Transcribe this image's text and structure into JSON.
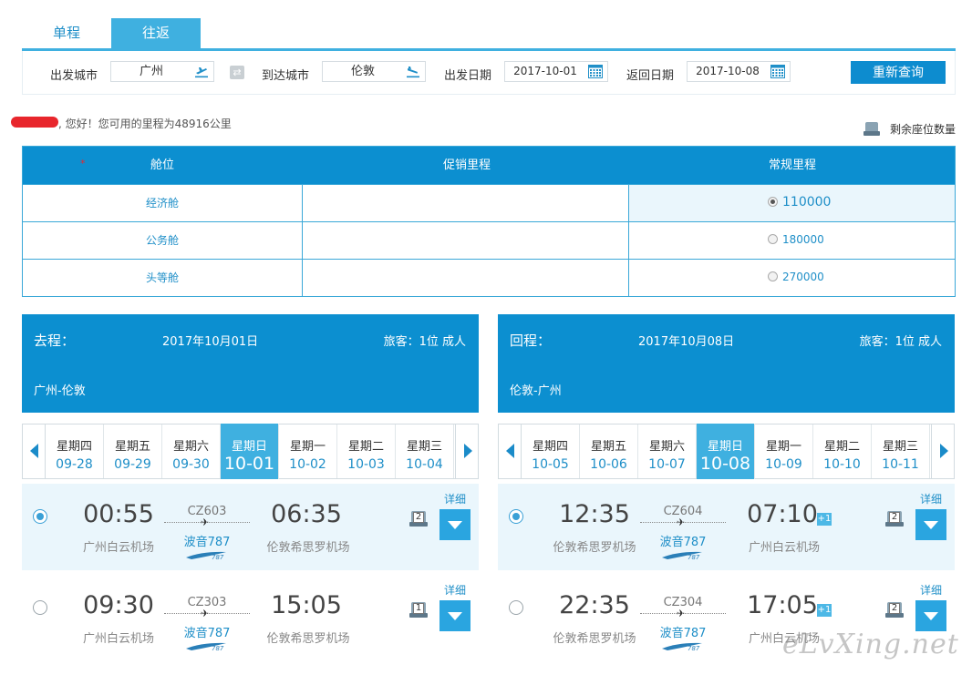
{
  "tabs": [
    {
      "label": "单程",
      "active": false
    },
    {
      "label": "往返",
      "active": true
    }
  ],
  "search": {
    "from_label": "出发城市",
    "from_value": "广州",
    "to_label": "到达城市",
    "to_value": "伦敦",
    "depart_label": "出发日期",
    "depart_value": "2017-10-01",
    "return_label": "返回日期",
    "return_value": "2017-10-08",
    "requery_label": "重新查询"
  },
  "greeting": ", 您好！您可用的里程为48916公里",
  "seat_legend": "剩余座位数量",
  "cabin_table": {
    "headers": [
      "舱位",
      "促销里程",
      "常规里程"
    ],
    "rows": [
      {
        "cabin": "经济舱",
        "promo": "",
        "regular": "110000",
        "selected": true
      },
      {
        "cabin": "公务舱",
        "promo": "",
        "regular": "180000",
        "selected": false
      },
      {
        "cabin": "头等舱",
        "promo": "",
        "regular": "270000",
        "selected": false
      }
    ]
  },
  "outbound": {
    "title": "去程：",
    "date": "2017年10月01日",
    "passengers": "旅客：1位 成人",
    "route": "广州-伦敦",
    "days": [
      {
        "weekday": "星期四",
        "date": "09-28",
        "current": false
      },
      {
        "weekday": "星期五",
        "date": "09-29",
        "current": false
      },
      {
        "weekday": "星期六",
        "date": "09-30",
        "current": false
      },
      {
        "weekday": "星期日",
        "date": "10-01",
        "current": true
      },
      {
        "weekday": "星期一",
        "date": "10-02",
        "current": false
      },
      {
        "weekday": "星期二",
        "date": "10-03",
        "current": false
      },
      {
        "weekday": "星期三",
        "date": "10-04",
        "current": false
      }
    ],
    "flights": [
      {
        "selected": true,
        "depart_time": "00:55",
        "depart_airport": "广州白云机场",
        "flight_no": "CZ603",
        "aircraft": "波音787",
        "arrive_time": "06:35",
        "arrive_airport": "伦敦希思罗机场",
        "next_day": "",
        "seats": "2",
        "detail": "详细"
      },
      {
        "selected": false,
        "depart_time": "09:30",
        "depart_airport": "广州白云机场",
        "flight_no": "CZ303",
        "aircraft": "波音787",
        "arrive_time": "15:05",
        "arrive_airport": "伦敦希思罗机场",
        "next_day": "",
        "seats": "1",
        "detail": "详细"
      }
    ]
  },
  "return": {
    "title": "回程：",
    "date": "2017年10月08日",
    "passengers": "旅客：1位 成人",
    "route": "伦敦-广州",
    "days": [
      {
        "weekday": "星期四",
        "date": "10-05",
        "current": false
      },
      {
        "weekday": "星期五",
        "date": "10-06",
        "current": false
      },
      {
        "weekday": "星期六",
        "date": "10-07",
        "current": false
      },
      {
        "weekday": "星期日",
        "date": "10-08",
        "current": true
      },
      {
        "weekday": "星期一",
        "date": "10-09",
        "current": false
      },
      {
        "weekday": "星期二",
        "date": "10-10",
        "current": false
      },
      {
        "weekday": "星期三",
        "date": "10-11",
        "current": false
      }
    ],
    "flights": [
      {
        "selected": true,
        "depart_time": "12:35",
        "depart_airport": "伦敦希思罗机场",
        "flight_no": "CZ604",
        "aircraft": "波音787",
        "arrive_time": "07:10",
        "arrive_airport": "广州白云机场",
        "next_day": "+1",
        "seats": "2",
        "detail": "详细"
      },
      {
        "selected": false,
        "depart_time": "22:35",
        "depart_airport": "伦敦希思罗机场",
        "flight_no": "CZ304",
        "aircraft": "波音787",
        "arrive_time": "17:05",
        "arrive_airport": "广州白云机场",
        "next_day": "+1",
        "seats": "2",
        "detail": "详细"
      }
    ]
  },
  "watermark": "eLvXing.net",
  "colors": {
    "primary": "#0c8fd0",
    "accent": "#3fb0e0",
    "link": "#1f8fc8"
  }
}
